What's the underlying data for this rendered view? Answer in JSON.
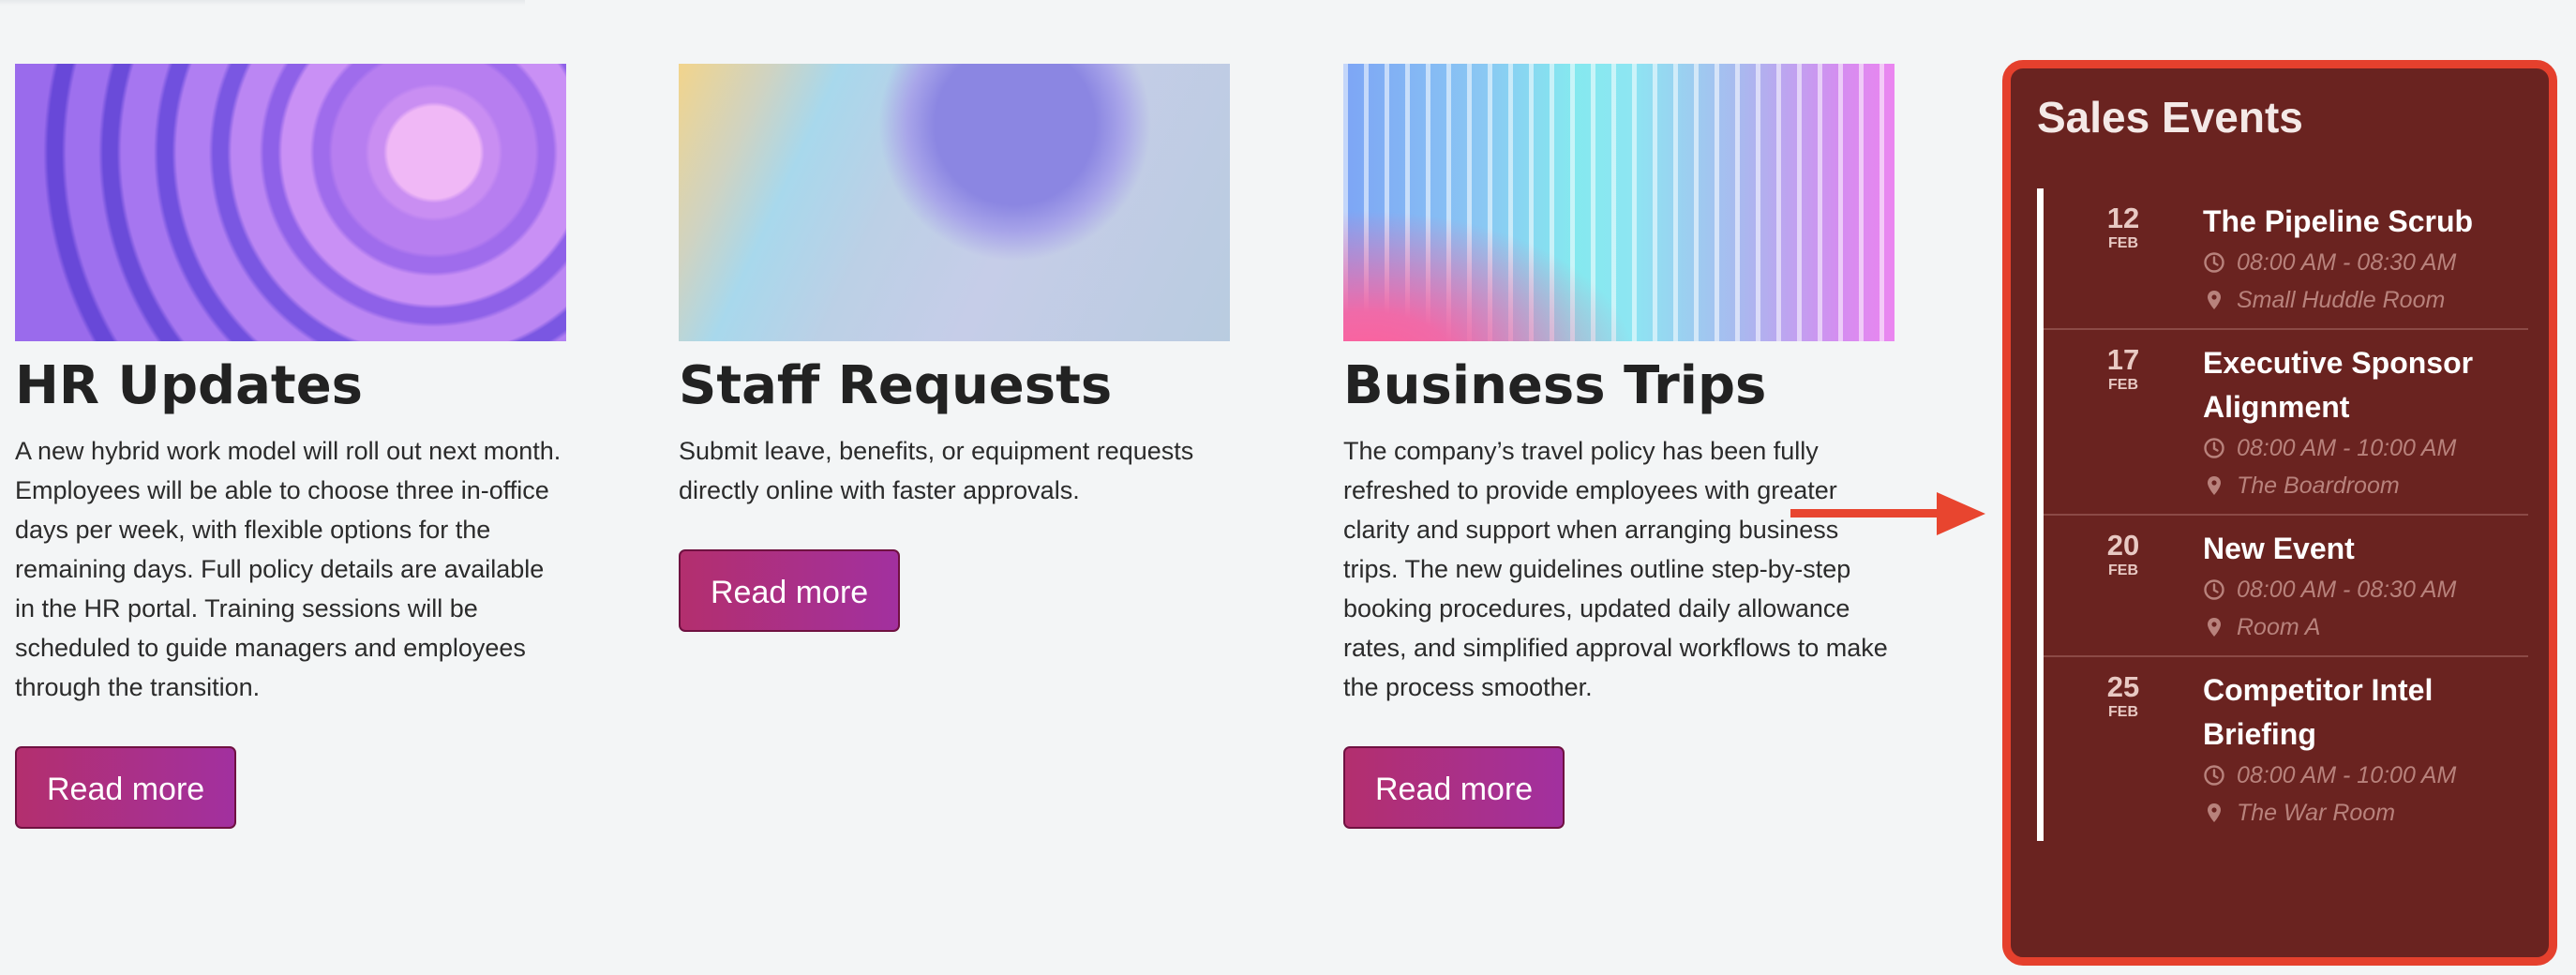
{
  "cards": [
    {
      "title": "HR Updates",
      "text": "A new hybrid work model will roll out next month. Employees will be able to choose three in-office days per week, with flexible options for the remaining days. Full policy details are available in the HR portal. Training sessions will be scheduled to guide managers and employees through the transition.",
      "button": "Read more"
    },
    {
      "title": "Staff Requests",
      "text": "Submit leave, benefits, or equipment requests directly online with faster approvals.",
      "button": "Read more"
    },
    {
      "title": "Business Trips",
      "text": "The company’s travel policy has been fully refreshed to provide employees with greater clarity and support when arranging business trips. The new guidelines outline step-by-step booking procedures, updated daily allowance rates, and simplified approval workflows to make the process smoother.",
      "button": "Read more"
    }
  ],
  "events_panel": {
    "title": "Sales Events",
    "events": [
      {
        "day": "12",
        "month": "FEB",
        "title": "The Pipeline Scrub",
        "time": "08:00 AM - 08:30 AM",
        "location": "Small Huddle Room"
      },
      {
        "day": "17",
        "month": "FEB",
        "title": "Executive Sponsor Alignment",
        "time": "08:00 AM - 10:00 AM",
        "location": "The Boardroom"
      },
      {
        "day": "20",
        "month": "FEB",
        "title": "New Event",
        "time": "08:00 AM - 08:30 AM",
        "location": "Room A"
      },
      {
        "day": "25",
        "month": "FEB",
        "title": "Competitor Intel Briefing",
        "time": "08:00 AM - 10:00 AM",
        "location": "The War Room"
      }
    ]
  },
  "icons": {
    "time": "clock-icon",
    "location": "map-pin-icon",
    "annotation": "arrow-right-icon"
  },
  "colors": {
    "panel_bg": "#6a2320",
    "panel_border": "#e5402d",
    "button_start": "#b32f6e",
    "button_end": "#a2309f",
    "annotation_arrow": "#e8452f"
  }
}
